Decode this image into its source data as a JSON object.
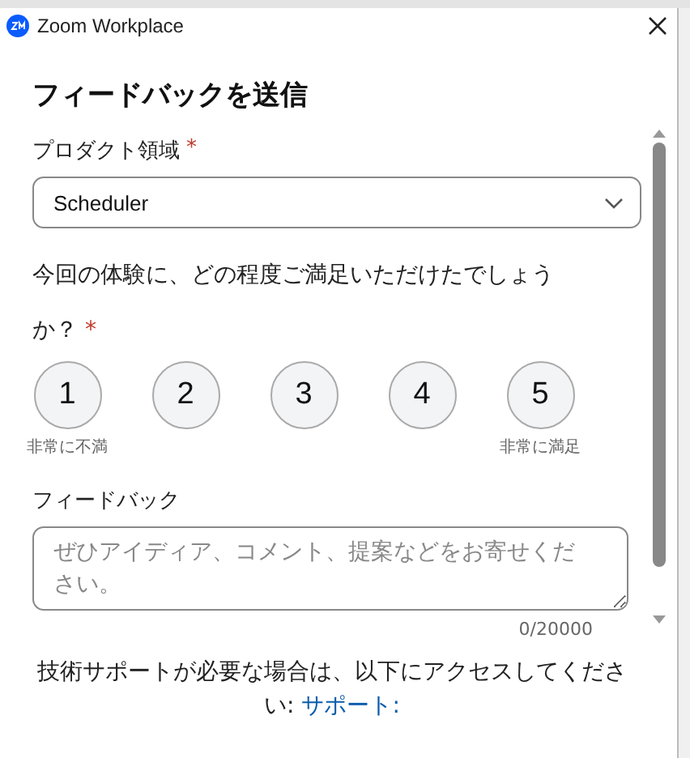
{
  "window": {
    "title": "Zoom Workplace"
  },
  "heading": "フィードバックを送信",
  "product_area": {
    "label": "プロダクト領域",
    "required_mark": "*",
    "value": "Scheduler"
  },
  "question": {
    "text": "今回の体験に、どの程度ご満足いただけたでしょうか？",
    "required_mark": "*"
  },
  "rating": [
    {
      "label": "1",
      "selected": false,
      "caption": "非常に不満"
    },
    {
      "label": "2",
      "selected": false
    },
    {
      "label": "3",
      "selected": false
    },
    {
      "label": "4",
      "selected": false
    },
    {
      "label": "5",
      "selected": false,
      "caption": "非常に満足"
    }
  ],
  "feedback": {
    "label": "フィードバック",
    "placeholder": "ぜひアイディア、コメント、提案などをお寄せください。",
    "counter": "0/20000"
  },
  "support": {
    "text": "技術サポートが必要な場合は、以下にアクセスしてください: ",
    "link": "サポート:"
  }
}
